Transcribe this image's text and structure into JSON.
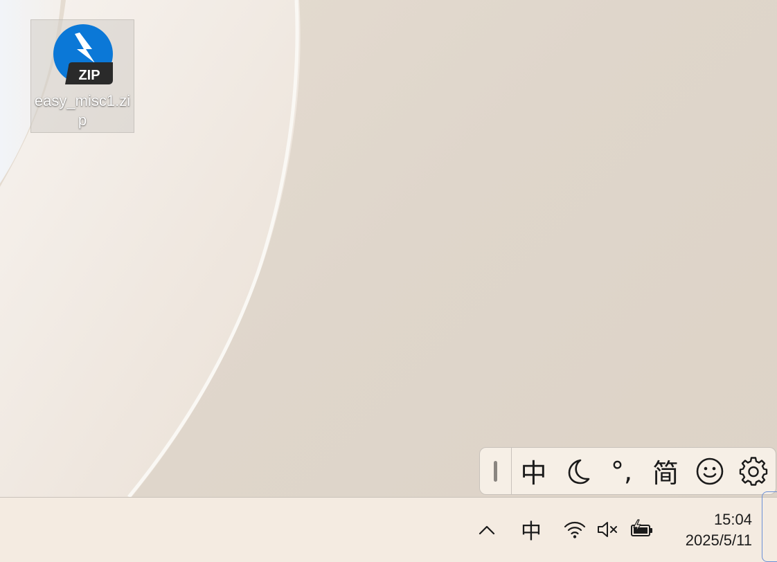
{
  "desktop": {
    "icons": [
      {
        "label": "easy_misc1.zip",
        "badge_text": "ZIP",
        "icon": "zip-archive-icon"
      }
    ]
  },
  "ime_toolbar": {
    "mode_label": "中",
    "punct_label": "°,",
    "script_label": "简",
    "icons": [
      "grip-handle-icon",
      "moon-icon",
      "smiley-icon",
      "gear-icon"
    ]
  },
  "taskbar": {
    "tray": {
      "ime_label": "中",
      "icons": [
        "chevron-up-icon",
        "wifi-icon",
        "speaker-muted-icon",
        "battery-charging-icon"
      ]
    },
    "clock": {
      "time": "15:04",
      "date": "2025/5/11"
    }
  },
  "colors": {
    "wallpaper": "#ded5ca",
    "taskbar": "#f4ebe1",
    "zip_blue": "#0b78d7",
    "zip_badge": "#2a2a2a"
  }
}
